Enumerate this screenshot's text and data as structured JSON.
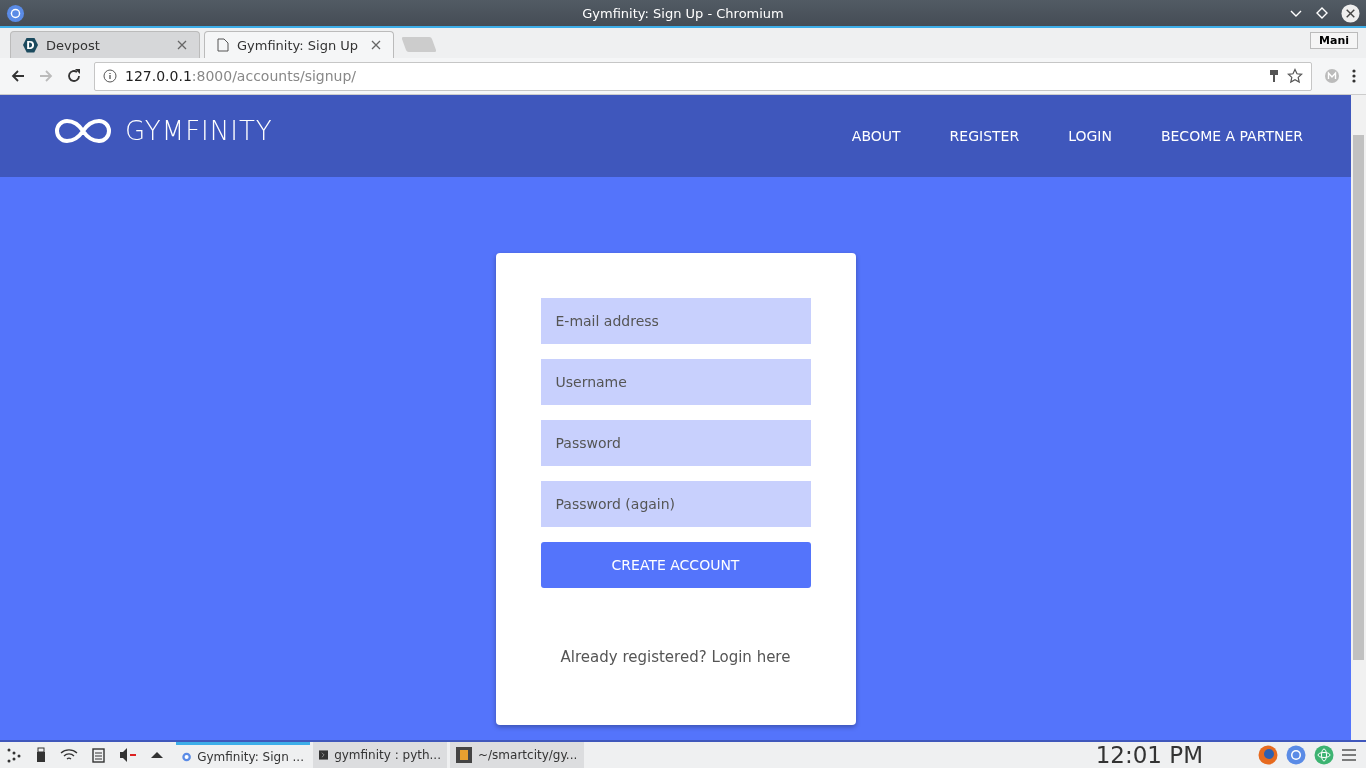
{
  "window": {
    "title": "Gymfinity: Sign Up - Chromium"
  },
  "tabs": [
    {
      "label": "Devpost",
      "icon": "D",
      "selected": false
    },
    {
      "label": "Gymfinity: Sign Up",
      "selected": true
    }
  ],
  "profile": "Mani",
  "address": {
    "host": "127.0.0.1",
    "path": ":8000/accounts/signup/"
  },
  "site": {
    "logo": "GYMFINITY",
    "nav": [
      "ABOUT",
      "REGISTER",
      "LOGIN",
      "BECOME A PARTNER"
    ]
  },
  "form": {
    "fields": [
      {
        "placeholder": "E-mail address"
      },
      {
        "placeholder": "Username"
      },
      {
        "placeholder": "Password"
      },
      {
        "placeholder": "Password (again)"
      }
    ],
    "submit": "CREATE ACCOUNT",
    "footer": "Already registered? Login here"
  },
  "taskbar": {
    "tasks": [
      {
        "label": "Gymfinity: Sign ...",
        "kind": "browser",
        "selected": true
      },
      {
        "label": "gymfinity : pyth...",
        "kind": "terminal",
        "selected": false
      },
      {
        "label": "~/smartcity/gy...",
        "kind": "editor",
        "selected": false
      }
    ],
    "clock": "12:01 PM"
  }
}
